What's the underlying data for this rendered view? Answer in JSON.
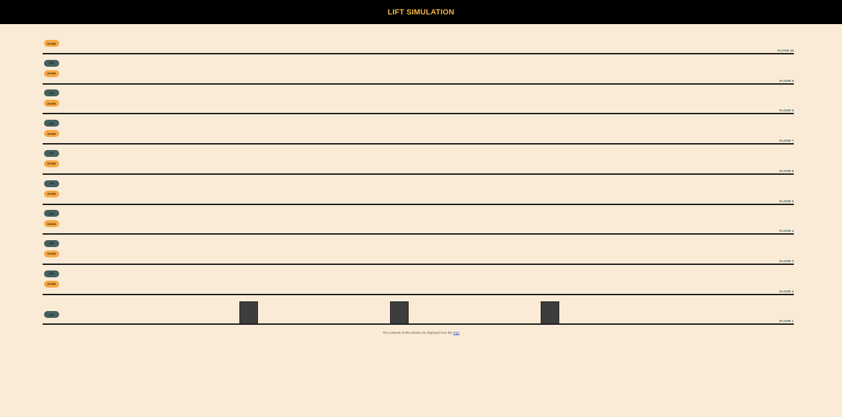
{
  "header": {
    "title": "LIFT SIMULATION"
  },
  "floors": [
    {
      "label": "FLOOR 10",
      "up": null,
      "down": "DOWN"
    },
    {
      "label": "FLOOR 9",
      "up": "UP",
      "down": "DOWN"
    },
    {
      "label": "FLOOR 8",
      "up": "UP",
      "down": "DOWN"
    },
    {
      "label": "FLOOR 7",
      "up": "UP",
      "down": "DOWN"
    },
    {
      "label": "FLOOR 6",
      "up": "UP",
      "down": "DOWN"
    },
    {
      "label": "FLOOR 5",
      "up": "UP",
      "down": "DOWN"
    },
    {
      "label": "FLOOR 4",
      "up": "UP",
      "down": "DOWN"
    },
    {
      "label": "FLOOR 3",
      "up": "UP",
      "down": "DOWN"
    },
    {
      "label": "FLOOR 2",
      "up": "UP",
      "down": "DOWN"
    },
    {
      "label": "FLOOR 1",
      "up": "UP",
      "down": null
    }
  ],
  "lifts": [
    {
      "floor": 1
    },
    {
      "floor": 1
    },
    {
      "floor": 1
    }
  ],
  "footer": {
    "text": "The contents of this website are deployed from this",
    "link_text": "repo"
  },
  "colors": {
    "background": "#faebd7",
    "header_bg": "#000000",
    "header_text": "#f5b841",
    "up_button": "#44605f",
    "down_button": "#f5a945",
    "lift": "#3d3d3d"
  }
}
